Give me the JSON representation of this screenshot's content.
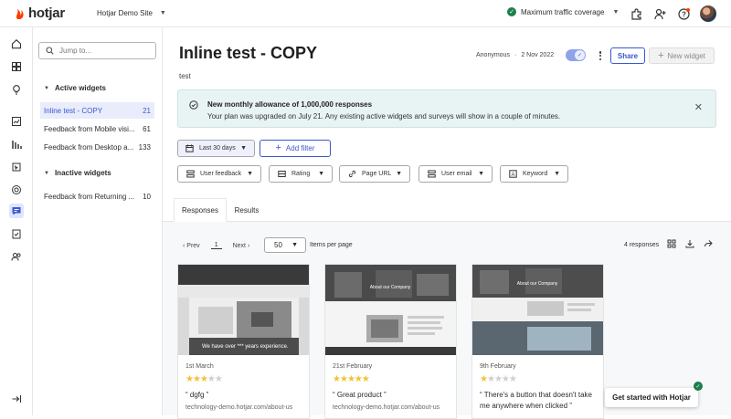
{
  "app": {
    "brand": "hotjar",
    "site": "Hotjar Demo Site",
    "traffic": "Maximum traffic coverage"
  },
  "sidebar": {
    "search_placeholder": "Jump to...",
    "active_heading": "Active widgets",
    "inactive_heading": "Inactive widgets",
    "active_items": [
      {
        "label": "Inline test - COPY",
        "count": "21"
      },
      {
        "label": "Feedback from Mobile visi...",
        "count": "61"
      },
      {
        "label": "Feedback from Desktop a...",
        "count": "133"
      }
    ],
    "inactive_items": [
      {
        "label": "Feedback from Returning ...",
        "count": "10"
      }
    ]
  },
  "header": {
    "title": "Inline test - COPY",
    "subtitle": "test",
    "author": "Anonymous",
    "sep": "·",
    "date": "2 Nov 2022",
    "share_label": "Share",
    "new_widget_label": "New widget",
    "enabled": true
  },
  "banner": {
    "title": "New monthly allowance of 1,000,000 responses",
    "text": "Your plan was upgraded on July 21. Any existing active widgets and surveys will show in a couple of minutes."
  },
  "filters": {
    "range": "Last 30 days",
    "add_filter": "Add filter",
    "chips": [
      "User feedback",
      "Rating",
      "Page URL",
      "User email",
      "Keyword"
    ]
  },
  "tabs": [
    "Responses",
    "Results"
  ],
  "pager": {
    "prev": "Prev",
    "page": "1",
    "next": "Next",
    "per_page": "50",
    "per_page_label": "Items per page",
    "count": "4 responses"
  },
  "cards": [
    {
      "date": "1st March",
      "rating": 3,
      "quote": "“ dgfg ”",
      "url": "technology-demo.hotjar.com/about-us",
      "thumb_caption": "We have over *** years experience."
    },
    {
      "date": "21st February",
      "rating": 5,
      "quote": "“ Great product ”",
      "url": "technology-demo.hotjar.com/about-us",
      "thumb_caption": "About our Company"
    },
    {
      "date": "9th February",
      "rating": 1,
      "quote": "“ There's a button that doesn't take me anywhere when clicked ”",
      "url": "",
      "thumb_caption": "About our Company"
    }
  ],
  "helper": {
    "label": "Get started with Hotjar"
  },
  "colors": {
    "accent": "#3a57cf",
    "brand": "#ff3c00",
    "success": "#1b7f4c",
    "banner_bg": "#e8f4f3",
    "star": "#f2c233"
  }
}
